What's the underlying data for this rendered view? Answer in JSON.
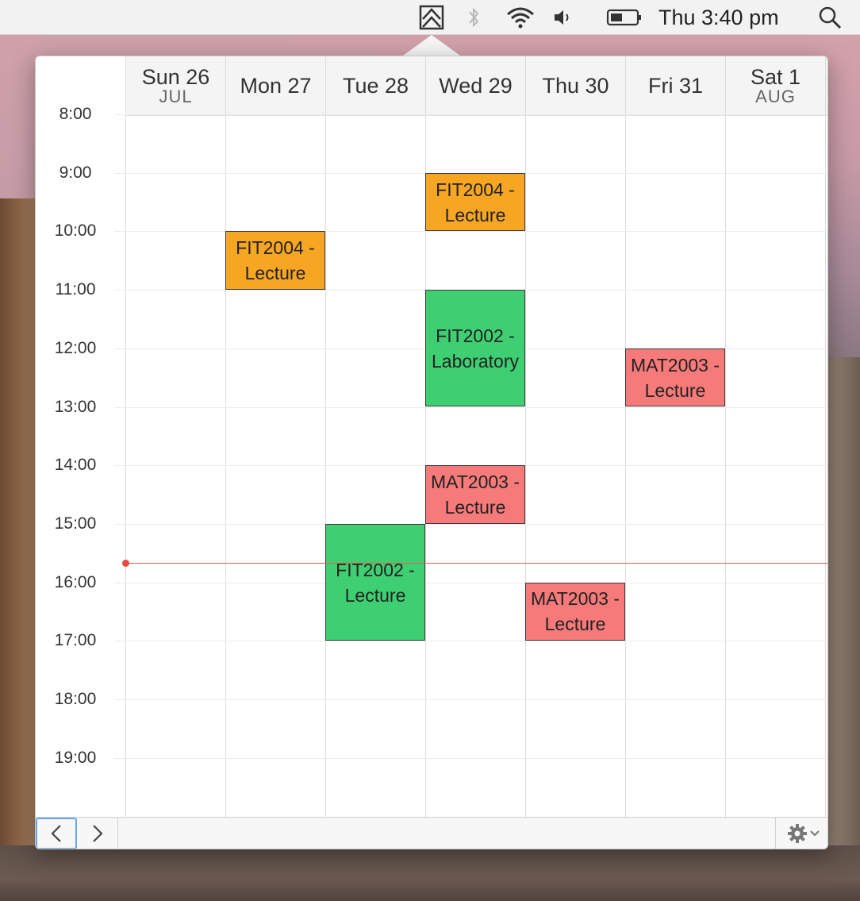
{
  "menubar": {
    "app_icon": "calendar-app-icon",
    "icons": [
      "bluetooth-icon",
      "wifi-icon",
      "volume-icon",
      "battery-icon",
      "search-icon"
    ],
    "clock": "Thu 3:40 pm"
  },
  "calendar": {
    "days": [
      {
        "name": "Sun 26",
        "month": "JUL"
      },
      {
        "name": "Mon 27",
        "month": ""
      },
      {
        "name": "Tue 28",
        "month": ""
      },
      {
        "name": "Wed 29",
        "month": ""
      },
      {
        "name": "Thu 30",
        "month": ""
      },
      {
        "name": "Fri 31",
        "month": ""
      },
      {
        "name": "Sat 1",
        "month": "AUG"
      }
    ],
    "hours": [
      "8:00",
      "9:00",
      "10:00",
      "11:00",
      "12:00",
      "13:00",
      "14:00",
      "15:00",
      "16:00",
      "17:00",
      "18:00",
      "19:00"
    ],
    "current_time": "15:40",
    "events": [
      {
        "title": "FIT2004 - Lecture",
        "day": 3,
        "start": 9,
        "end": 10,
        "color": "#f7a624"
      },
      {
        "title": "FIT2004 - Lecture",
        "day": 1,
        "start": 10,
        "end": 11,
        "color": "#f7a624"
      },
      {
        "title": "FIT2002 - Laboratory",
        "day": 3,
        "start": 11,
        "end": 13,
        "color": "#3ecf72"
      },
      {
        "title": "MAT2003 - Lecture",
        "day": 5,
        "start": 12,
        "end": 13,
        "color": "#f77a7a"
      },
      {
        "title": "MAT2003 - Lecture",
        "day": 3,
        "start": 14,
        "end": 15,
        "color": "#f77a7a"
      },
      {
        "title": "FIT2002 - Lecture",
        "day": 2,
        "start": 15,
        "end": 17,
        "color": "#3ecf72"
      },
      {
        "title": "MAT2003 - Lecture",
        "day": 4,
        "start": 16,
        "end": 17,
        "color": "#f77a7a"
      }
    ]
  },
  "toolbar": {
    "prev_icon": "chevron-left-icon",
    "next_icon": "chevron-right-icon",
    "settings_icon": "gear-icon"
  }
}
